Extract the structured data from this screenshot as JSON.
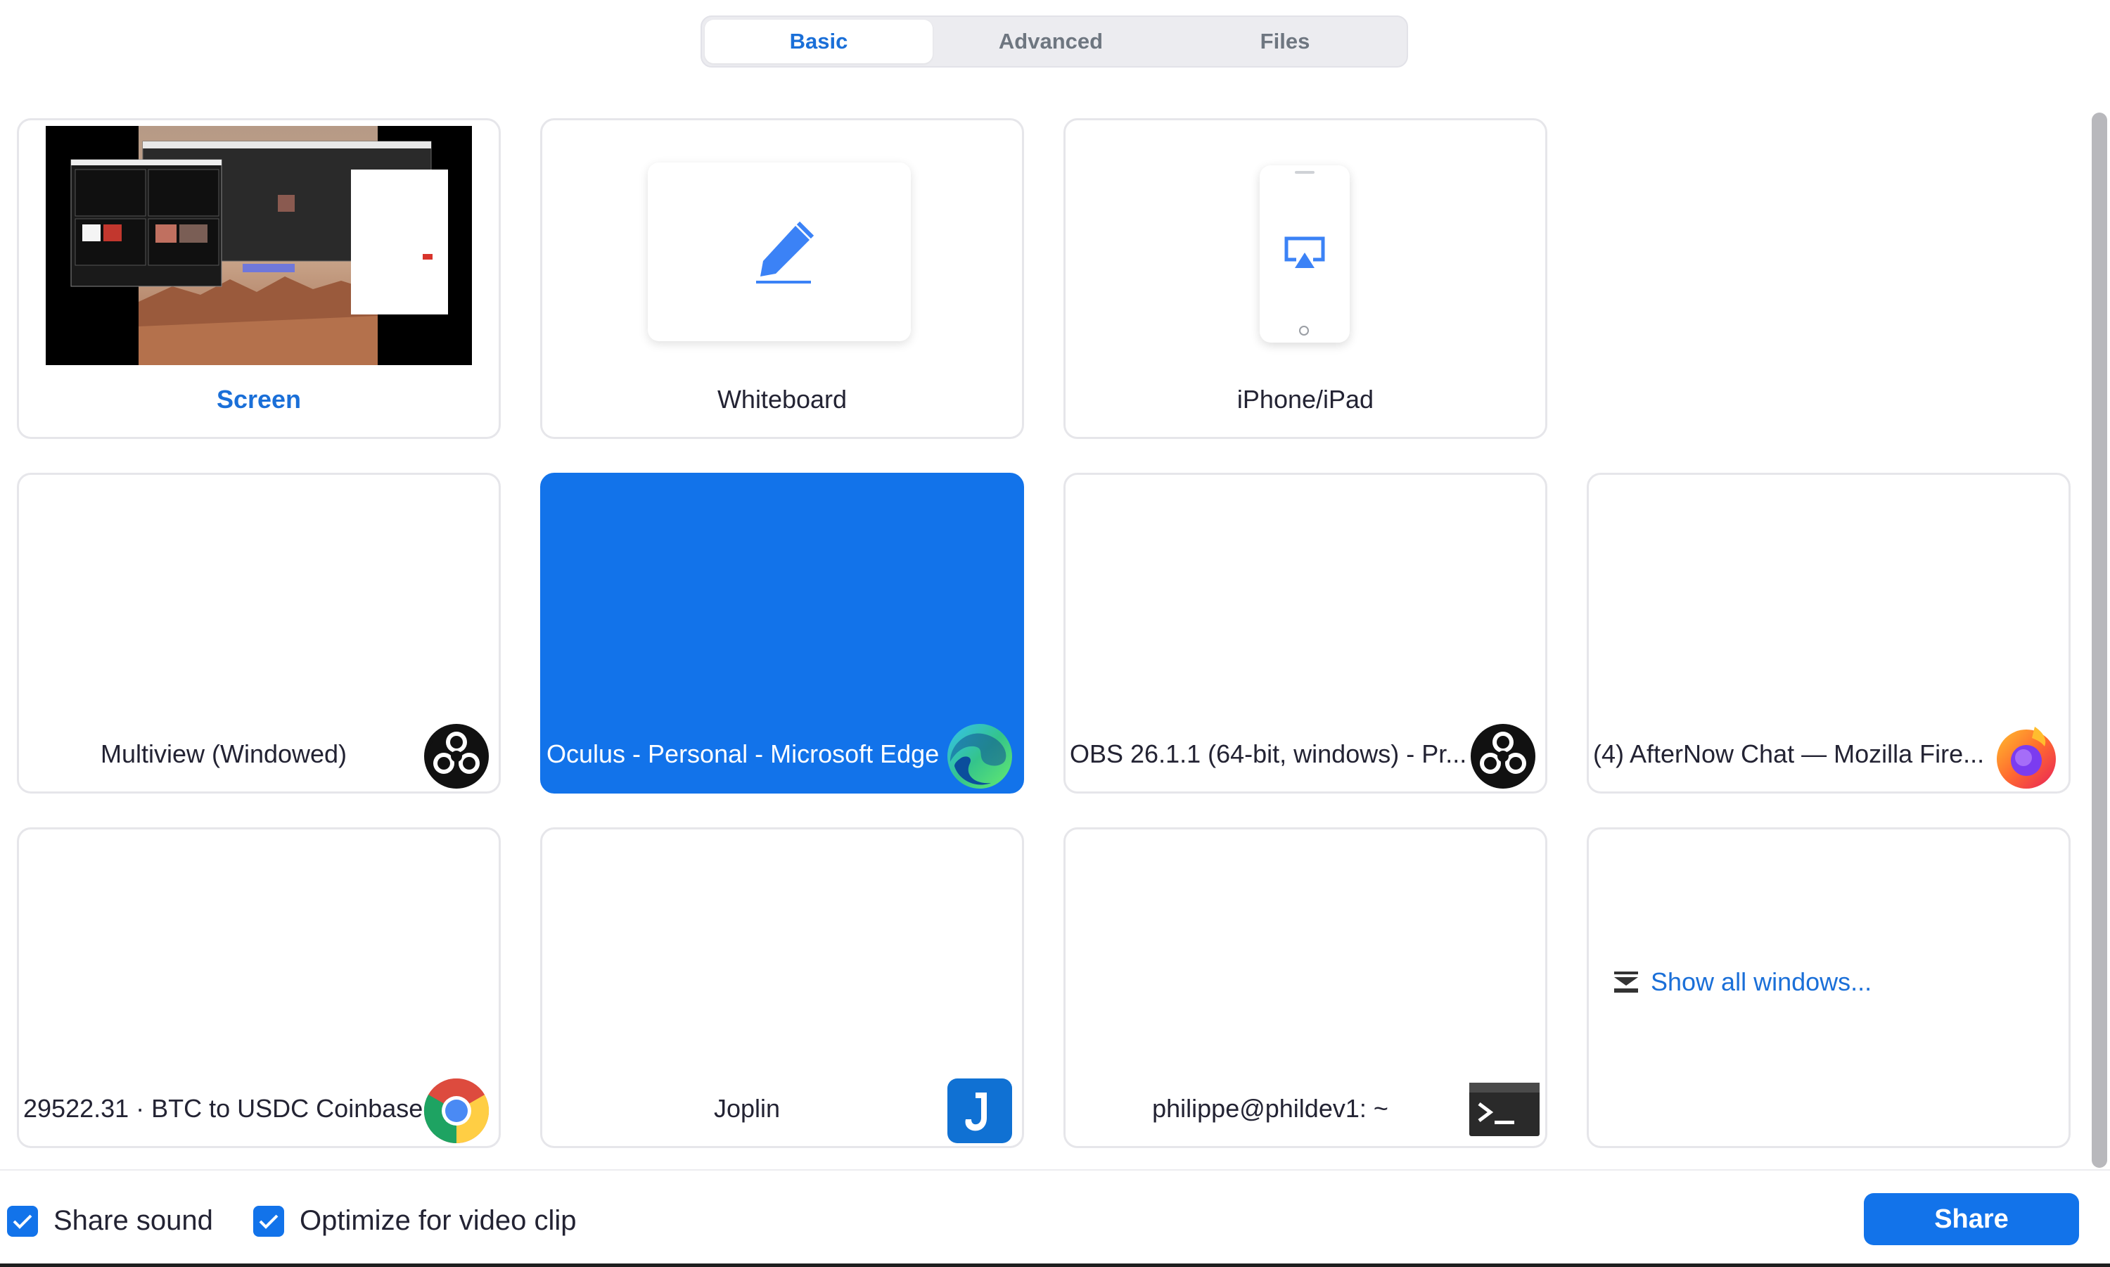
{
  "tabs": [
    {
      "label": "Basic",
      "active": true
    },
    {
      "label": "Advanced",
      "active": false
    },
    {
      "label": "Files",
      "active": false
    }
  ],
  "tiles": {
    "screen": {
      "label": "Screen"
    },
    "whiteboard": {
      "label": "Whiteboard",
      "icon": "pencil-icon"
    },
    "iphone_ipad": {
      "label": "iPhone/iPad",
      "icon": "airplay-icon"
    },
    "windows": [
      {
        "label": "Multiview (Windowed)",
        "icon": "obs-icon",
        "selected": false
      },
      {
        "label": "Oculus - Personal - Microsoft Edge",
        "icon": "edge-icon",
        "selected": true
      },
      {
        "label": "OBS 26.1.1 (64-bit, windows) - Pr...",
        "icon": "obs-icon",
        "selected": false
      },
      {
        "label": "(4) AfterNow Chat — Mozilla Fire...",
        "icon": "firefox-icon",
        "selected": false
      },
      {
        "label": "29522.31 · BTC to USDC Coinbase...",
        "icon": "chrome-icon",
        "selected": false
      },
      {
        "label": "Joplin",
        "icon": "joplin-icon",
        "selected": false
      },
      {
        "label": "philippe@phildev1: ~",
        "icon": "terminal-icon",
        "selected": false
      }
    ],
    "show_all": {
      "label": "Show all windows...",
      "icon": "show-all-windows-icon"
    }
  },
  "footer": {
    "share_sound": {
      "label": "Share sound",
      "checked": true
    },
    "optimize_video": {
      "label": "Optimize for video clip",
      "checked": true
    },
    "share_button": "Share"
  },
  "colors": {
    "accent": "#1273ea",
    "accent_text": "#1a6fd8",
    "tile_border": "#e6e6ea"
  }
}
